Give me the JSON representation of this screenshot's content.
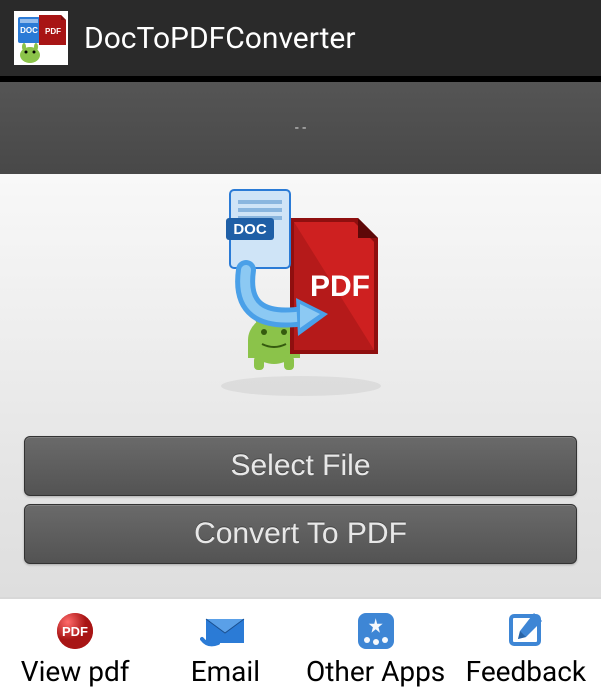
{
  "titlebar": {
    "title": "DocToPDFConverter",
    "icon": "doc-to-pdf-app-icon"
  },
  "banner": {
    "text": "- -"
  },
  "hero": {
    "doc_badge": "DOC",
    "pdf_badge": "PDF",
    "icon": "doc-to-pdf-hero-icon"
  },
  "buttons": {
    "select_file": "Select File",
    "convert": "Convert To PDF"
  },
  "bottom": {
    "items": [
      {
        "label": "View pdf",
        "icon": "pdf-badge-icon"
      },
      {
        "label": "Email",
        "icon": "mail-icon"
      },
      {
        "label": "Other Apps",
        "icon": "appstore-icon"
      },
      {
        "label": "Feedback",
        "icon": "edit-icon"
      }
    ]
  },
  "colors": {
    "titlebar_bg": "#2a2a2a",
    "banner_bg": "#4d4d4d",
    "button_bg": "#5d5d5d",
    "pdf_red": "#a81515",
    "doc_blue": "#2b7bd6",
    "accent_blue": "#3e86d5"
  }
}
